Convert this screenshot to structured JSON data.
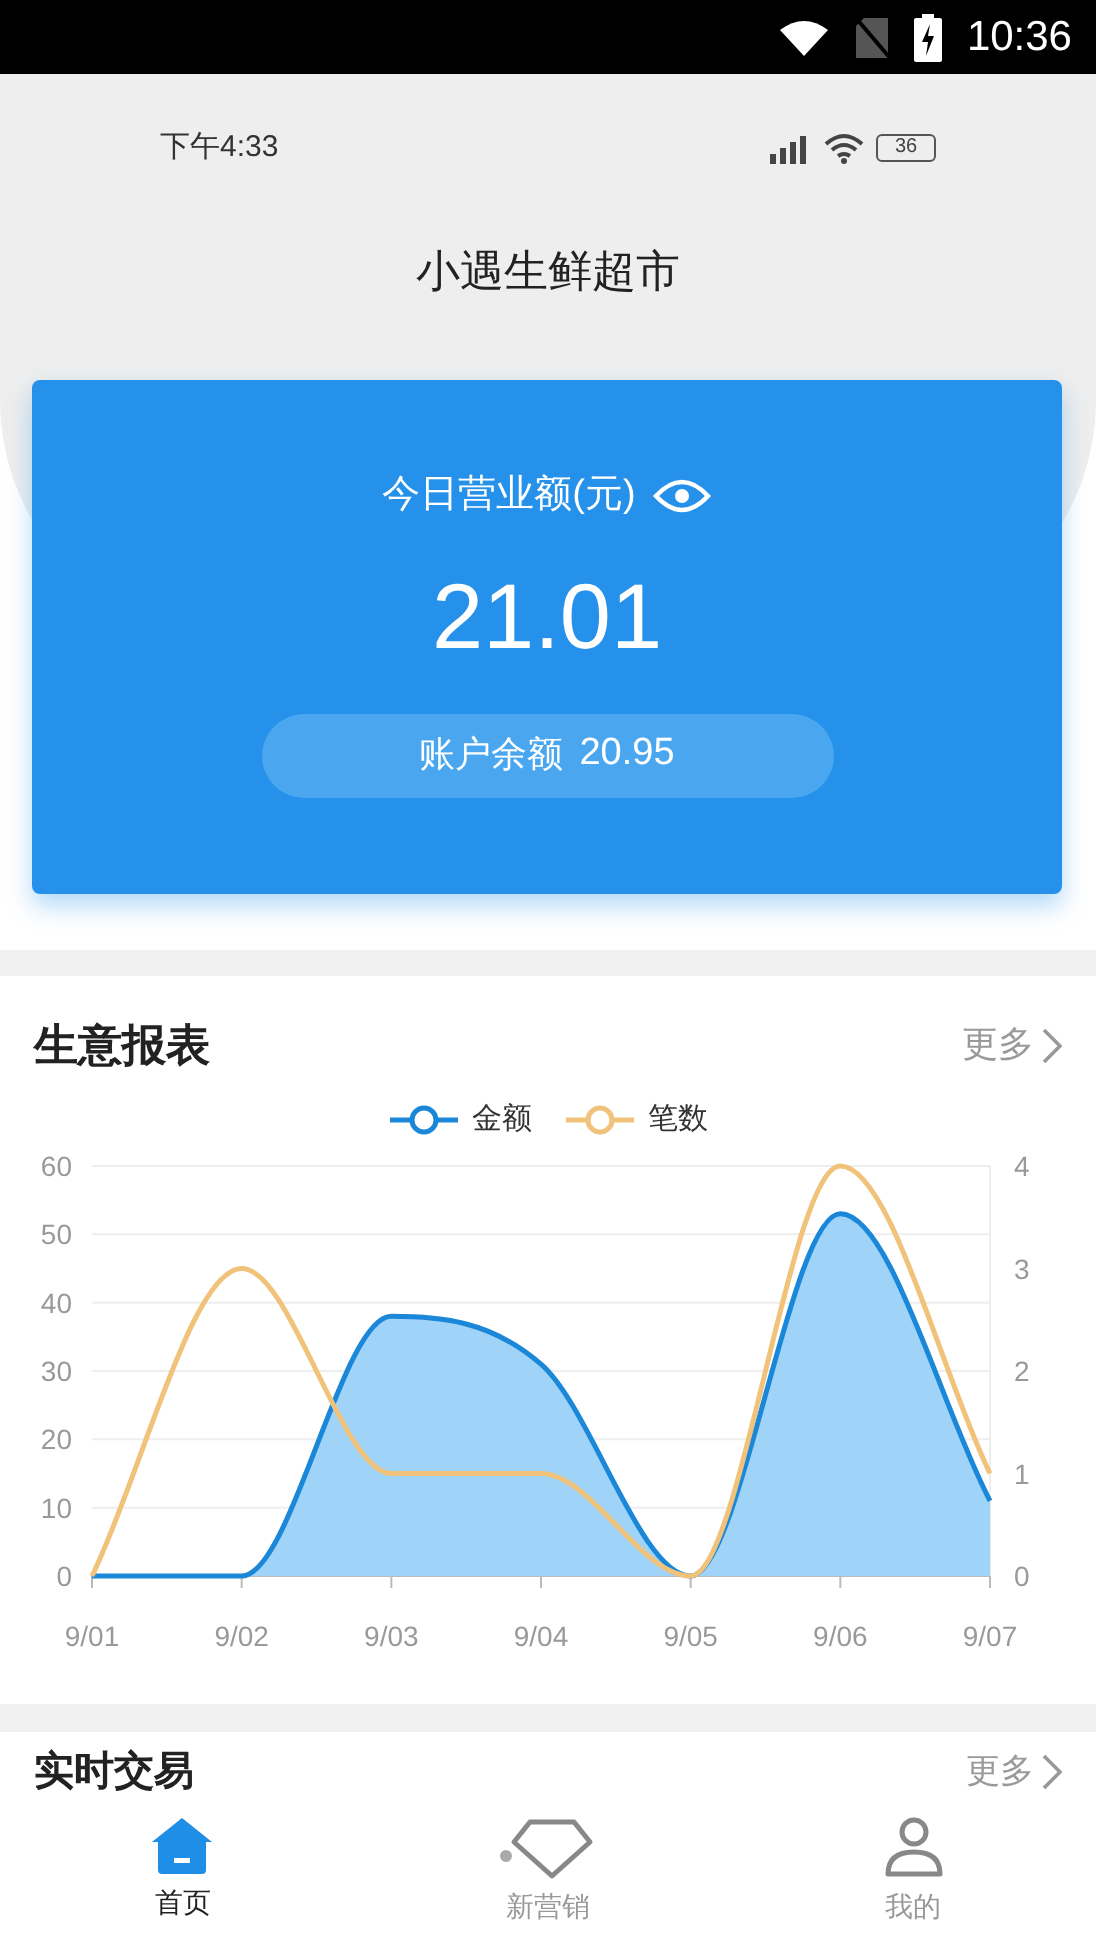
{
  "system_status": {
    "time": "10:36"
  },
  "app_status": {
    "time": "下午4:33",
    "battery": "36"
  },
  "title": "小遇生鲜超市",
  "revenue_card": {
    "label": "今日营业额(元)",
    "amount": "21.01",
    "balance_label": "账户余额",
    "balance": "20.95"
  },
  "report": {
    "title": "生意报表",
    "more": "更多",
    "chart_data": {
      "type": "line",
      "grid": true,
      "categories": [
        "9/01",
        "9/02",
        "9/03",
        "9/04",
        "9/05",
        "9/06",
        "9/07"
      ],
      "series": [
        {
          "name": "金额",
          "color": "#1a87d8",
          "type": "area",
          "values": [
            0,
            0,
            38,
            31,
            0,
            53,
            11
          ]
        },
        {
          "name": "笔数",
          "color": "#f0c27a",
          "type": "line",
          "axis": "y2",
          "values": [
            0,
            3,
            1,
            1,
            0,
            4,
            1
          ]
        }
      ],
      "ylim": [
        0,
        60
      ],
      "yticks": [
        0,
        10,
        20,
        30,
        40,
        50,
        60
      ],
      "y2lim": [
        0,
        4
      ],
      "y2ticks": [
        0,
        1,
        2,
        3,
        4
      ]
    }
  },
  "transactions": {
    "title": "实时交易",
    "more": "更多"
  },
  "tabs": [
    {
      "label": "首页",
      "kind": "home",
      "selected": true
    },
    {
      "label": "新营销",
      "kind": "diamond",
      "selected": false
    },
    {
      "label": "我的",
      "kind": "person",
      "selected": false
    }
  ]
}
